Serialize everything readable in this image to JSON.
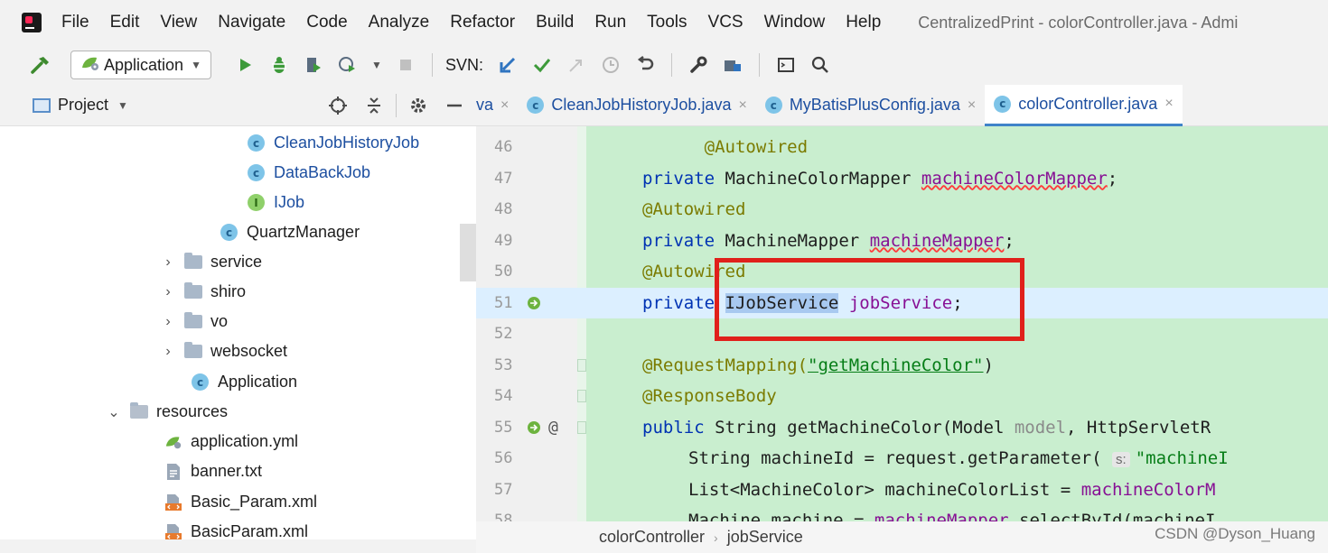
{
  "menubar": {
    "items": [
      "File",
      "Edit",
      "View",
      "Navigate",
      "Code",
      "Analyze",
      "Refactor",
      "Build",
      "Run",
      "Tools",
      "VCS",
      "Window",
      "Help"
    ],
    "window_title": "CentralizedPrint - colorController.java - Admi"
  },
  "toolbar": {
    "run_config": "Application",
    "svn_label": "SVN:"
  },
  "project": {
    "title": "Project",
    "tree": [
      {
        "label": "CleanJobHistoryJob",
        "kind": "class"
      },
      {
        "label": "DataBackJob",
        "kind": "class"
      },
      {
        "label": "IJob",
        "kind": "interface"
      },
      {
        "label": "QuartzManager",
        "kind": "class"
      },
      {
        "label": "service",
        "kind": "folder"
      },
      {
        "label": "shiro",
        "kind": "folder"
      },
      {
        "label": "vo",
        "kind": "folder"
      },
      {
        "label": "websocket",
        "kind": "folder"
      },
      {
        "label": "Application",
        "kind": "spring-class"
      },
      {
        "label": "resources",
        "kind": "resources-folder"
      },
      {
        "label": "application.yml",
        "kind": "yml"
      },
      {
        "label": "banner.txt",
        "kind": "txt"
      },
      {
        "label": "Basic_Param.xml",
        "kind": "xml"
      },
      {
        "label": "BasicParam.xml",
        "kind": "xml"
      }
    ]
  },
  "tabs": [
    {
      "label": "va",
      "close": "×"
    },
    {
      "label": "CleanJobHistoryJob.java",
      "close": "×"
    },
    {
      "label": "MyBatisPlusConfig.java",
      "close": "×"
    },
    {
      "label": "colorController.java",
      "close": "×"
    }
  ],
  "editor": {
    "line_numbers": [
      "46",
      "47",
      "48",
      "49",
      "50",
      "51",
      "52",
      "53",
      "54",
      "55",
      "56",
      "57",
      "58"
    ],
    "tokens": {
      "autowired": "@Autowired",
      "private": "private",
      "type_mcm": "MachineColorMapper",
      "field_mcm": "machineColorMapper",
      "semi": ";",
      "type_mm": "MachineMapper",
      "field_mm": "machineMapper",
      "type_ijs": "IJobService",
      "field_js": "jobService",
      "request_mapping": "@RequestMapping(",
      "mapping_value": "\"getMachineColor\"",
      "close_paren": ")",
      "response_body": "@ResponseBody",
      "public": "public",
      "sig_rest": "String getMachineColor(Model ",
      "param_model": "model",
      "sig_tail": ", HttpServletR",
      "l56_a": "String machineId = request.getParameter(",
      "l56_hint": "s:",
      "l56_str": "\"machineI",
      "l57_a": "List<MachineColor> machineColorList = ",
      "l57_field": "machineColorM",
      "l58_a": "Machine machine = ",
      "l58_field": "machineMapper",
      "l58_b": ".selectById(machineI"
    }
  },
  "breadcrumb": {
    "items": [
      "colorController",
      "jobService"
    ],
    "separator": "›"
  },
  "watermark": "CSDN @Dyson_Huang",
  "colors": {
    "highlight_box": "#e0201b",
    "code_background": "#c9eecf",
    "keyword": "#0033b3",
    "field": "#871094"
  }
}
